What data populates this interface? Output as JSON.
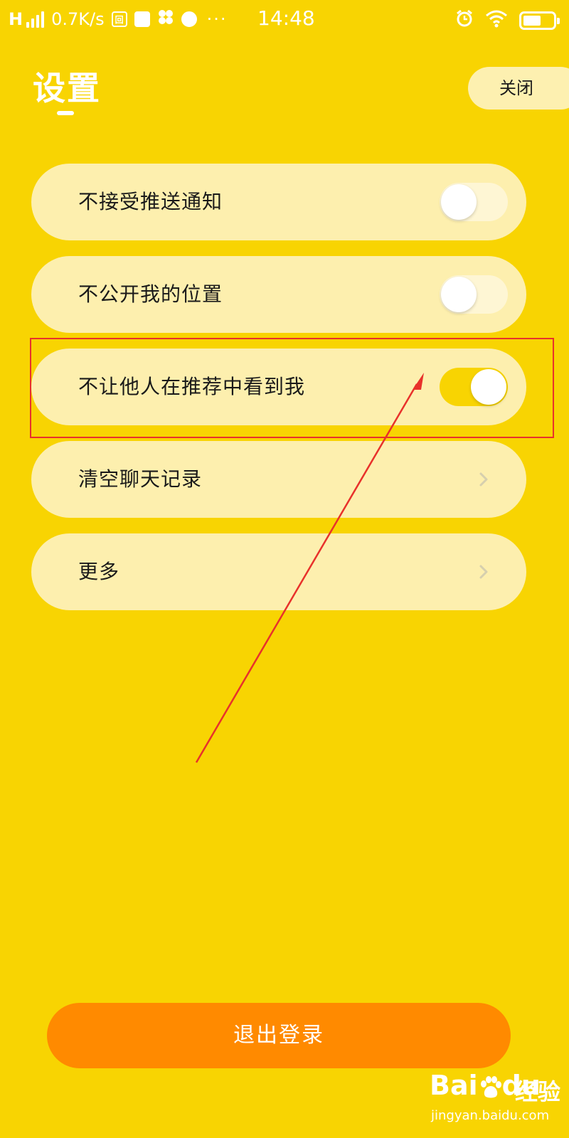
{
  "status_bar": {
    "network": "H",
    "speed": "0.7K/s",
    "time": "14:48",
    "more": "···",
    "battery_level": 0.6
  },
  "header": {
    "title": "设置",
    "close_label": "关闭"
  },
  "settings": [
    {
      "label": "不接受推送通知",
      "control": "toggle",
      "on": false
    },
    {
      "label": "不公开我的位置",
      "control": "toggle",
      "on": false
    },
    {
      "label": "不让他人在推荐中看到我",
      "control": "toggle",
      "on": true
    },
    {
      "label": "清空聊天记录",
      "control": "chevron"
    },
    {
      "label": "更多",
      "control": "chevron"
    }
  ],
  "logout_label": "退出登录",
  "watermark": {
    "brand": "Bai",
    "brand_suffix": "du",
    "product": "经验",
    "url": "jingyan.baidu.com"
  },
  "colors": {
    "background": "#F8D402",
    "row": "#FDEFAE",
    "logout": "#FF8A00",
    "annotation": "#E8312B"
  }
}
